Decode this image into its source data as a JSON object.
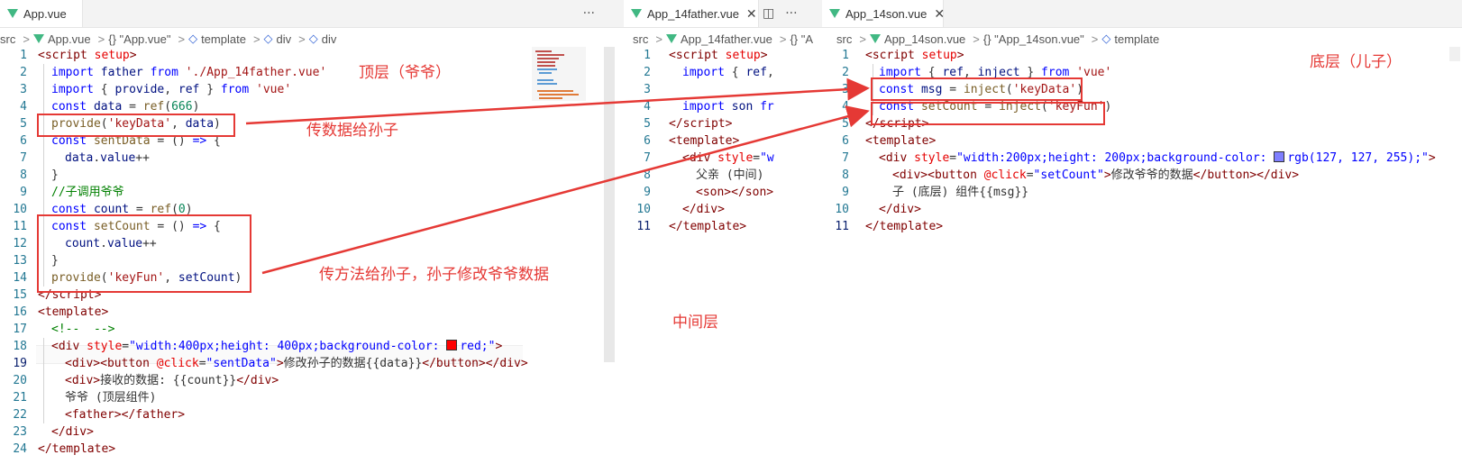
{
  "panes": {
    "app": {
      "tab_label": "App.vue",
      "more_icon": "ellipsis-icon",
      "breadcrumb": [
        "src",
        "App.vue",
        "{} \"App.vue\"",
        "template",
        "div",
        "div"
      ],
      "lines": [
        {
          "n": "1"
        },
        {
          "n": "2"
        },
        {
          "n": "3"
        },
        {
          "n": "4"
        },
        {
          "n": "5"
        },
        {
          "n": "6"
        },
        {
          "n": "7"
        },
        {
          "n": "8"
        },
        {
          "n": "9"
        },
        {
          "n": "10"
        },
        {
          "n": "11"
        },
        {
          "n": "12"
        },
        {
          "n": "13"
        },
        {
          "n": "14"
        },
        {
          "n": "15"
        },
        {
          "n": "16"
        },
        {
          "n": "17"
        },
        {
          "n": "18"
        },
        {
          "n": "19"
        },
        {
          "n": "20"
        },
        {
          "n": "21"
        },
        {
          "n": "22"
        },
        {
          "n": "23"
        },
        {
          "n": "24"
        }
      ]
    },
    "father": {
      "tab_label": "App_14father.vue",
      "split_icon": "split-editor-icon",
      "more_icon": "ellipsis-icon",
      "breadcrumb": [
        "src",
        "App_14father.vue",
        "{} \"A"
      ],
      "lines": [
        {
          "n": "1"
        },
        {
          "n": "2"
        },
        {
          "n": "3"
        },
        {
          "n": "4"
        },
        {
          "n": "5"
        },
        {
          "n": "6"
        },
        {
          "n": "7"
        },
        {
          "n": "8"
        },
        {
          "n": "9"
        },
        {
          "n": "10"
        },
        {
          "n": "11"
        }
      ]
    },
    "son": {
      "tab_label": "App_14son.vue",
      "breadcrumb": [
        "src",
        "App_14son.vue",
        "{} \"App_14son.vue\"",
        "template"
      ],
      "lines": [
        {
          "n": "1"
        },
        {
          "n": "2"
        },
        {
          "n": "3"
        },
        {
          "n": "4"
        },
        {
          "n": "5"
        },
        {
          "n": "6"
        },
        {
          "n": "7"
        },
        {
          "n": "8"
        },
        {
          "n": "9"
        },
        {
          "n": "10"
        },
        {
          "n": "11"
        }
      ]
    }
  },
  "annotations": {
    "top_layer": "顶层（爷爷）",
    "pass_data": "传数据给孙子",
    "pass_method": "传方法给孙子，孙子修改爷爷数据",
    "middle_layer": "中间层",
    "bottom_layer": "底层（儿子）"
  },
  "colors": {
    "annotation_red": "#e53935",
    "swatch_red": "#ff0000",
    "swatch_blue": "#7f7fff"
  }
}
